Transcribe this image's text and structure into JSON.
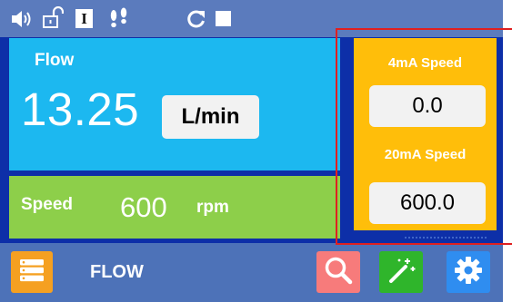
{
  "status_bar": {
    "icons": [
      "speaker-icon",
      "unlock-icon",
      "stop-info-icon",
      "footsteps-icon",
      "refresh-icon",
      "stop-icon"
    ],
    "info_glyph": "I"
  },
  "flow_panel": {
    "label": "Flow",
    "value": "13.25",
    "unit": "L/min"
  },
  "speed_panel": {
    "label": "Speed",
    "value": "600",
    "unit": "rpm"
  },
  "analog_panel": {
    "speed_4ma_label": "4mA Speed",
    "speed_4ma_value": "0.0",
    "speed_20ma_label": "20mA Speed",
    "speed_20ma_value": "600.0"
  },
  "bottom_bar": {
    "page_title": "FLOW",
    "buttons": [
      "menu-icon",
      "search-icon",
      "magic-wand-icon",
      "gear-icon"
    ]
  },
  "colors": {
    "screen_background": "#0d2fa8",
    "status_bar": "#5b7bbd",
    "flow_panel": "#1cb8f0",
    "speed_panel": "#8dcf4a",
    "analog_panel": "#ffbe0a",
    "bottom_bar": "#4d72b8",
    "menu_button": "#f5a021",
    "search_button": "#f77b7b",
    "wand_button": "#2fb52b",
    "gear_button": "#2f8df0",
    "annotation_red": "#e02020"
  }
}
